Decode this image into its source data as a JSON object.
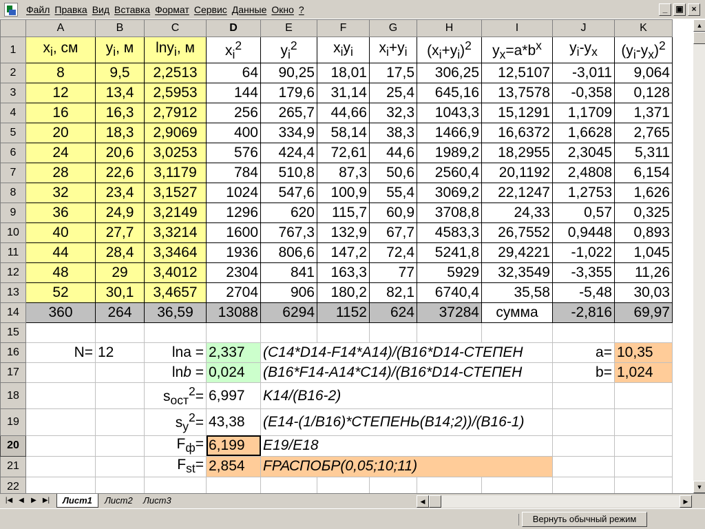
{
  "menubar": {
    "items": [
      "Файл",
      "Правка",
      "Вид",
      "Вставка",
      "Формат",
      "Сервис",
      "Данные",
      "Окно",
      "?"
    ],
    "min_glyph": "_",
    "restore_glyph": "▣",
    "close_glyph": "×"
  },
  "columns": [
    "A",
    "B",
    "C",
    "D",
    "E",
    "F",
    "G",
    "H",
    "I",
    "J",
    "K"
  ],
  "active_column": "D",
  "active_row": 20,
  "rows": [
    {
      "n": 1,
      "cells": [
        {
          "v": "x<sub>i</sub>, см",
          "cl": "ty c"
        },
        {
          "v": "y<sub>i</sub>, м",
          "cl": "ty c"
        },
        {
          "v": "lny<sub>i</sub>, м",
          "cl": "ty c"
        },
        {
          "v": "x<sub>i</sub><sup>2</sup>",
          "cl": "tw c"
        },
        {
          "v": "y<sub>i</sub><sup>2</sup>",
          "cl": "tw c"
        },
        {
          "v": "x<sub>i</sub>y<sub>i</sub>",
          "cl": "tw c"
        },
        {
          "v": "x<sub>i</sub>+y<sub>i</sub>",
          "cl": "tw c"
        },
        {
          "v": "(x<sub>i</sub>+y<sub>i</sub>)<sup>2</sup>",
          "cl": "tw c"
        },
        {
          "v": "y<sub>x</sub>=a*b<sup>x</sup>",
          "cl": "tw c"
        },
        {
          "v": "y<sub>i</sub>-y<sub>x</sub>",
          "cl": "tw c"
        },
        {
          "v": "(y<sub>i</sub>-y<sub>x</sub>)<sup>2</sup>",
          "cl": "tw c"
        }
      ]
    },
    {
      "n": 2,
      "v": [
        "8",
        "9,5",
        "2,2513",
        "64",
        "90,25",
        "18,01",
        "17,5",
        "306,25",
        "12,5107",
        "-3,011",
        "9,064"
      ]
    },
    {
      "n": 3,
      "v": [
        "12",
        "13,4",
        "2,5953",
        "144",
        "179,6",
        "31,14",
        "25,4",
        "645,16",
        "13,7578",
        "-0,358",
        "0,128"
      ]
    },
    {
      "n": 4,
      "v": [
        "16",
        "16,3",
        "2,7912",
        "256",
        "265,7",
        "44,66",
        "32,3",
        "1043,3",
        "15,1291",
        "1,1709",
        "1,371"
      ]
    },
    {
      "n": 5,
      "v": [
        "20",
        "18,3",
        "2,9069",
        "400",
        "334,9",
        "58,14",
        "38,3",
        "1466,9",
        "16,6372",
        "1,6628",
        "2,765"
      ]
    },
    {
      "n": 6,
      "v": [
        "24",
        "20,6",
        "3,0253",
        "576",
        "424,4",
        "72,61",
        "44,6",
        "1989,2",
        "18,2955",
        "2,3045",
        "5,311"
      ]
    },
    {
      "n": 7,
      "v": [
        "28",
        "22,6",
        "3,1179",
        "784",
        "510,8",
        "87,3",
        "50,6",
        "2560,4",
        "20,1192",
        "2,4808",
        "6,154"
      ]
    },
    {
      "n": 8,
      "v": [
        "32",
        "23,4",
        "3,1527",
        "1024",
        "547,6",
        "100,9",
        "55,4",
        "3069,2",
        "22,1247",
        "1,2753",
        "1,626"
      ]
    },
    {
      "n": 9,
      "v": [
        "36",
        "24,9",
        "3,2149",
        "1296",
        "620",
        "115,7",
        "60,9",
        "3708,8",
        "24,33",
        "0,57",
        "0,325"
      ]
    },
    {
      "n": 10,
      "v": [
        "40",
        "27,7",
        "3,3214",
        "1600",
        "767,3",
        "132,9",
        "67,7",
        "4583,3",
        "26,7552",
        "0,9448",
        "0,893"
      ]
    },
    {
      "n": 11,
      "v": [
        "44",
        "28,4",
        "3,3464",
        "1936",
        "806,6",
        "147,2",
        "72,4",
        "5241,8",
        "29,4221",
        "-1,022",
        "1,045"
      ]
    },
    {
      "n": 12,
      "v": [
        "48",
        "29",
        "3,4012",
        "2304",
        "841",
        "163,3",
        "77",
        "5929",
        "32,3549",
        "-3,355",
        "11,26"
      ]
    },
    {
      "n": 13,
      "v": [
        "52",
        "30,1",
        "3,4657",
        "2704",
        "906",
        "180,2",
        "82,1",
        "6740,4",
        "35,58",
        "-5,48",
        "30,03"
      ]
    },
    {
      "n": 14,
      "v": [
        "360",
        "264",
        "36,59",
        "13088",
        "6294",
        "1152",
        "624",
        "37284",
        "сумма",
        "-2,816",
        "69,97"
      ]
    },
    {
      "n": 15,
      "cells": []
    },
    {
      "n": 16,
      "cells": [
        {
          "v": "N=",
          "cl": "r"
        },
        {
          "v": "12",
          "cl": "l"
        },
        {
          "v": "lna =",
          "cl": "r"
        },
        {
          "v": "2,337",
          "cl": "tgr l"
        },
        {
          "v": "(C14*D14-F14*A14)/(B16*D14-СТЕПЕН",
          "cl": "l it",
          "span": 5
        },
        {
          "v": "a=",
          "cl": "r"
        },
        {
          "v": "10,35",
          "cl": "tor l"
        }
      ]
    },
    {
      "n": 17,
      "cells": [
        {
          "v": "",
          "cl": ""
        },
        {
          "v": "",
          "cl": ""
        },
        {
          "v": "ln<i>b</i> =",
          "cl": "r"
        },
        {
          "v": "0,024",
          "cl": "tgr l"
        },
        {
          "v": "(B16*F14-A14*C14)/(B16*D14-СТЕПЕН",
          "cl": "l it",
          "span": 5
        },
        {
          "v": "b=",
          "cl": "r"
        },
        {
          "v": "1,024",
          "cl": "tor l"
        }
      ]
    },
    {
      "n": 18,
      "cells": [
        {
          "v": "",
          "cl": ""
        },
        {
          "v": "",
          "cl": ""
        },
        {
          "v": "s<sub>ост</sub><sup>2</sup>=",
          "cl": "r"
        },
        {
          "v": "6,997",
          "cl": "l"
        },
        {
          "v": "K14/(B16-2)",
          "cl": "l it",
          "span": 5
        },
        {
          "v": "",
          "cl": ""
        },
        {
          "v": "",
          "cl": ""
        }
      ]
    },
    {
      "n": 19,
      "cells": [
        {
          "v": "",
          "cl": ""
        },
        {
          "v": "",
          "cl": ""
        },
        {
          "v": "s<sub>y</sub><sup>2</sup>=",
          "cl": "r"
        },
        {
          "v": "43,38",
          "cl": "l"
        },
        {
          "v": "(E14-(1/B16)*СТЕПЕНЬ(B14;2))/(B16-1)",
          "cl": "l it",
          "span": 5
        },
        {
          "v": "",
          "cl": ""
        },
        {
          "v": "",
          "cl": ""
        }
      ]
    },
    {
      "n": 20,
      "cells": [
        {
          "v": "",
          "cl": ""
        },
        {
          "v": "",
          "cl": ""
        },
        {
          "v": "F<sub>ф</sub>=",
          "cl": "r"
        },
        {
          "v": "6,199",
          "cl": "tor l active"
        },
        {
          "v": "E19/E18",
          "cl": "l it",
          "span": 5
        },
        {
          "v": "",
          "cl": ""
        },
        {
          "v": "",
          "cl": ""
        }
      ]
    },
    {
      "n": 21,
      "cells": [
        {
          "v": "",
          "cl": ""
        },
        {
          "v": "",
          "cl": ""
        },
        {
          "v": "F<sub>st</sub>=",
          "cl": "r"
        },
        {
          "v": "2,854",
          "cl": "tor l"
        },
        {
          "v": "FРАСПОБР(0,05;10;11)",
          "cl": "tor l it",
          "span": 5
        },
        {
          "v": "",
          "cl": ""
        },
        {
          "v": "",
          "cl": ""
        }
      ]
    },
    {
      "n": 22,
      "cells": []
    }
  ],
  "tabs": [
    "Лист1",
    "Лист2",
    "Лист3"
  ],
  "active_tab": "Лист1",
  "status": {
    "fullscreen_button": "Вернуть обычный режим"
  },
  "colors": {
    "yellow": "#ffff99",
    "gray": "#c0c0c0",
    "green": "#ccffcc",
    "orange": "#ffcc99"
  }
}
